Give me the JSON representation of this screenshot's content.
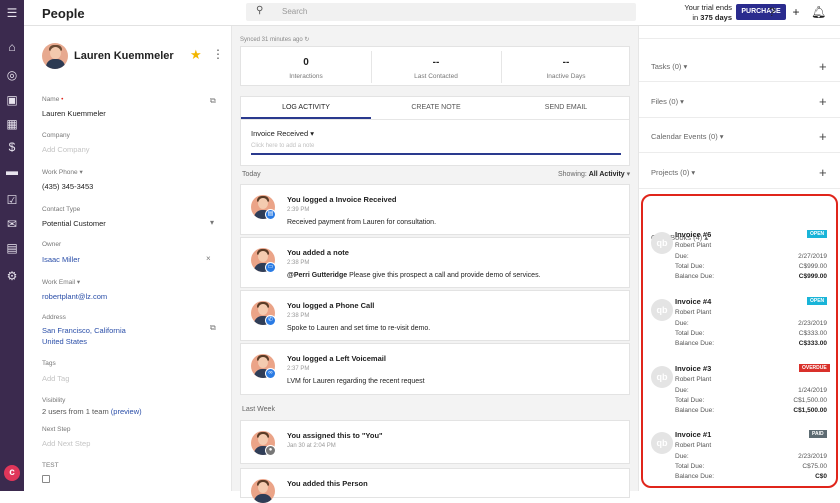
{
  "header": {
    "title": "People",
    "search_placeholder": "Search",
    "trial_line1": "Your trial ends",
    "trial_prefix": "in",
    "trial_days": "375 days",
    "purchase_label": "PURCHASE"
  },
  "sidebar": {
    "icons": [
      "menu-icon",
      "home-icon",
      "target-icon",
      "contacts-icon",
      "building-icon",
      "dollar-icon",
      "briefcase-icon",
      "checkbox-icon",
      "mail-icon",
      "chart-icon",
      "gear-icon"
    ],
    "logo_letter": "c"
  },
  "person": {
    "name": "Lauren Kuemmeler",
    "fields": {
      "name_label": "Name",
      "name_value": "Lauren Kuemmeler",
      "company_label": "Company",
      "company_placeholder": "Add Company",
      "phone_label": "Work Phone",
      "phone_value": "(435) 345-3453",
      "contact_type_label": "Contact Type",
      "contact_type_value": "Potential Customer",
      "owner_label": "Owner",
      "owner_value": "Isaac Miller",
      "email_label": "Work Email",
      "email_value": "robertplant@lz.com",
      "address_label": "Address",
      "address_line1": "San Francisco, California",
      "address_line2": "United States",
      "tags_label": "Tags",
      "tags_placeholder": "Add Tag",
      "visibility_label": "Visibility",
      "visibility_value": "2 users from 1 team",
      "visibility_link": "(preview)",
      "next_step_label": "Next Step",
      "next_step_placeholder": "Add Next Step",
      "test_label": "TEST"
    }
  },
  "activity": {
    "synced": "Synced 31 minutes ago",
    "stats": [
      {
        "value": "0",
        "label": "Interactions"
      },
      {
        "value": "--",
        "label": "Last Contacted"
      },
      {
        "value": "--",
        "label": "Inactive Days"
      }
    ],
    "tabs": [
      "LOG ACTIVITY",
      "CREATE NOTE",
      "SEND EMAIL"
    ],
    "type_dropdown": "Invoice Received",
    "event_placeholder": "Click here to add a note",
    "today_label": "Today",
    "showing_label": "Showing:",
    "showing_value": "All Activity",
    "last_week_label": "Last Week",
    "items": [
      {
        "title": "You logged a Invoice Received",
        "time": "2:39 PM",
        "detail_bold": "",
        "detail": "Received payment from Lauren for consultation.",
        "badge_color": "#2a7be4",
        "badge_icon": "invoice-icon"
      },
      {
        "title": "You added a note",
        "time": "2:38 PM",
        "detail_bold": "@Perri Gutteridge",
        "detail": "Please give this prospect a call and provide demo of services.",
        "badge_color": "#2a7be4",
        "badge_icon": "note-icon"
      },
      {
        "title": "You logged a Phone Call",
        "time": "2:38 PM",
        "detail_bold": "",
        "detail": "Spoke to Lauren and set time to re-visit demo.",
        "badge_color": "#2a7be4",
        "badge_icon": "phone-icon"
      },
      {
        "title": "You logged a Left Voicemail",
        "time": "2:37 PM",
        "detail_bold": "",
        "detail": "LVM for Lauren regarding the recent request",
        "badge_color": "#2a7be4",
        "badge_icon": "voicemail-icon"
      },
      {
        "title": "You assigned this to \"You\"",
        "time": "Jan 30 at 2:04 PM",
        "detail_bold": "",
        "detail": "",
        "badge_color": "#777777",
        "badge_icon": "user-icon"
      },
      {
        "title": "You added this Person",
        "time": "",
        "detail_bold": "",
        "detail": "",
        "badge_color": "#777777",
        "badge_icon": "user-icon"
      }
    ]
  },
  "right": {
    "sections": [
      "Tasks (0)",
      "Files (0)",
      "Calendar Events (0)",
      "Projects (0)"
    ],
    "quickbooks_label": "QuickBooks (4)",
    "invoice_labels": {
      "due": "Due:",
      "total": "Total Due:",
      "balance": "Balance Due:"
    },
    "invoices": [
      {
        "title": "Invoice #6",
        "status": "OPEN",
        "status_color": "#19b4d8",
        "customer": "Robert Plant",
        "due": "2/27/2019",
        "total": "C$999.00",
        "balance": "C$999.00"
      },
      {
        "title": "Invoice #4",
        "status": "OPEN",
        "status_color": "#19b4d8",
        "customer": "Robert Plant",
        "due": "2/23/2019",
        "total": "C$333.00",
        "balance": "C$333.00"
      },
      {
        "title": "Invoice #3",
        "status": "OVERDUE",
        "status_color": "#d9302a",
        "customer": "Robert Plant",
        "due": "1/24/2019",
        "total": "C$1,500.00",
        "balance": "C$1,500.00"
      },
      {
        "title": "Invoice #1",
        "status": "PAID",
        "status_color": "#5d6b72",
        "customer": "Robert Plant",
        "due": "2/23/2019",
        "total": "C$75.00",
        "balance": "C$0"
      }
    ]
  },
  "colors": {
    "sidebar": "#3b2a4e",
    "accent": "#2a2b8e",
    "highlight": "#e0251b"
  }
}
